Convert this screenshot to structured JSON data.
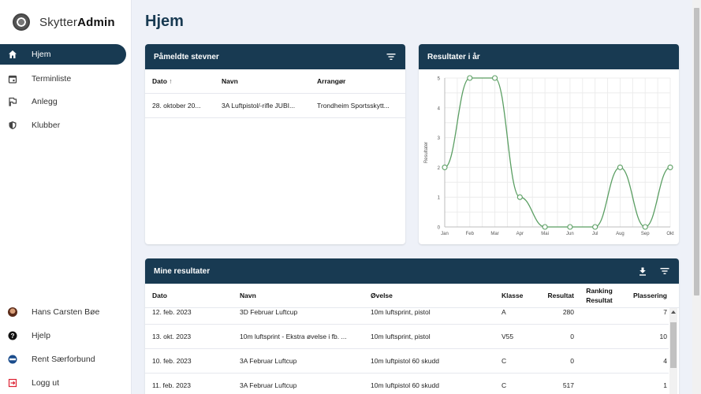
{
  "brand": {
    "light": "Skytter",
    "bold": "Admin"
  },
  "nav": {
    "items": [
      {
        "label": "Hjem",
        "icon": "home-icon"
      },
      {
        "label": "Terminliste",
        "icon": "calendar-icon"
      },
      {
        "label": "Anlegg",
        "icon": "flag-icon"
      },
      {
        "label": "Klubber",
        "icon": "shield-icon"
      }
    ],
    "bottom": [
      {
        "label": "Hans Carsten Bøe",
        "icon": "avatar"
      },
      {
        "label": "Hjelp",
        "icon": "help-icon"
      },
      {
        "label": "Rent Særforbund",
        "icon": "rent-icon"
      },
      {
        "label": "Logg ut",
        "icon": "logout-icon"
      }
    ]
  },
  "page": {
    "title": "Hjem"
  },
  "events": {
    "title": "Påmeldte stevner",
    "columns": [
      "Dato",
      "Navn",
      "Arrangør"
    ],
    "rows": [
      {
        "date": "28. oktober 20...",
        "name": "3A Luftpistol/-rifle JUBI...",
        "organizer": "Trondheim Sportsskytt..."
      }
    ]
  },
  "results_chart": {
    "title": "Resultater i år"
  },
  "chart_data": {
    "type": "line",
    "categories": [
      "Jan",
      "Feb",
      "Mar",
      "Apr",
      "Mai",
      "Jun",
      "Jul",
      "Aug",
      "Sep",
      "Okt"
    ],
    "values": [
      2,
      5,
      5,
      1,
      0,
      0,
      0,
      2,
      0,
      2
    ],
    "ylabel": "Resultater",
    "ylim": [
      0,
      5
    ],
    "yticks": [
      0,
      1,
      2,
      3,
      4,
      5
    ],
    "grid": true,
    "color": "#5a9e62"
  },
  "my_results": {
    "title": "Mine resultater",
    "columns": [
      "Dato",
      "Navn",
      "Øvelse",
      "Klasse",
      "Resultat",
      "Ranking Resultat",
      "Plassering"
    ],
    "rows": [
      {
        "date": "12. feb. 2023",
        "name": "3D Februar Luftcup",
        "exercise": "10m luftsprint, pistol",
        "class": "A",
        "result": "280",
        "ranking": "",
        "placement": "7"
      },
      {
        "date": "13. okt. 2023",
        "name": "10m luftsprint - Ekstra øvelse i fb. ...",
        "exercise": "10m luftsprint, pistol",
        "class": "V55",
        "result": "0",
        "ranking": "",
        "placement": "10"
      },
      {
        "date": "10. feb. 2023",
        "name": "3A Februar Luftcup",
        "exercise": "10m luftpistol 60 skudd",
        "class": "C",
        "result": "0",
        "ranking": "",
        "placement": "4"
      },
      {
        "date": "11. feb. 2023",
        "name": "3A Februar Luftcup",
        "exercise": "10m luftpistol 60 skudd",
        "class": "C",
        "result": "517",
        "ranking": "",
        "placement": "1"
      }
    ]
  }
}
